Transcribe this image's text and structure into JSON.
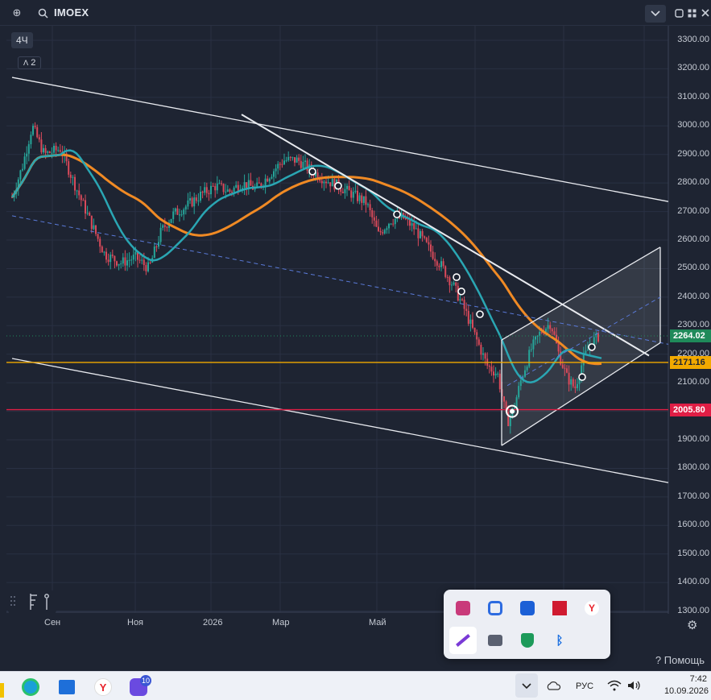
{
  "window": {
    "symbol": "IMOEX",
    "timeframe": "4Ч",
    "indicator_count": "2"
  },
  "help": {
    "label": "Помощь"
  },
  "chart_data": {
    "type": "candlestick",
    "y_axis_ticks": [
      "3300.00",
      "3200.00",
      "3100.00",
      "3000.00",
      "2900.00",
      "2800.00",
      "2700.00",
      "2600.00",
      "2500.00",
      "2400.00",
      "2300.00",
      "2200.00",
      "2100.00",
      "2000.00",
      "1900.00",
      "1800.00",
      "1700.00",
      "1600.00",
      "1500.00",
      "1400.00",
      "1300.00"
    ],
    "x_axis_ticks": [
      "Сен",
      "Ноя",
      "2026",
      "Мар",
      "Май"
    ],
    "ylim": [
      1250,
      3350
    ],
    "price_tags": [
      {
        "label": "2264.02",
        "value": 2264.02,
        "bg": "#1f8a5a",
        "fg": "#ffffff"
      },
      {
        "label": "2171.16",
        "value": 2171.16,
        "bg": "#f2a900",
        "fg": "#1e2432"
      },
      {
        "label": "2005.80",
        "value": 2005.8,
        "bg": "#e01e45",
        "fg": "#ffffff"
      }
    ],
    "horizontal_levels": [
      {
        "value": 2171.16,
        "color": "#f2a900"
      },
      {
        "value": 2005.8,
        "color": "#e01e45"
      },
      {
        "value": 2264.02,
        "color": "#1f8a5a",
        "style": "dotted"
      }
    ],
    "series": [
      {
        "name": "MA fast",
        "color": "#2aa6b3"
      },
      {
        "name": "MA slow",
        "color": "#f08a24"
      }
    ],
    "colors": {
      "up": "#26a69a",
      "down": "#d94a5a",
      "background": "#1e2432",
      "grid": "#293043"
    }
  },
  "taskbar": {
    "lang": "РУС",
    "time": "7:42",
    "date": "10.09.2026",
    "badge": "10"
  }
}
